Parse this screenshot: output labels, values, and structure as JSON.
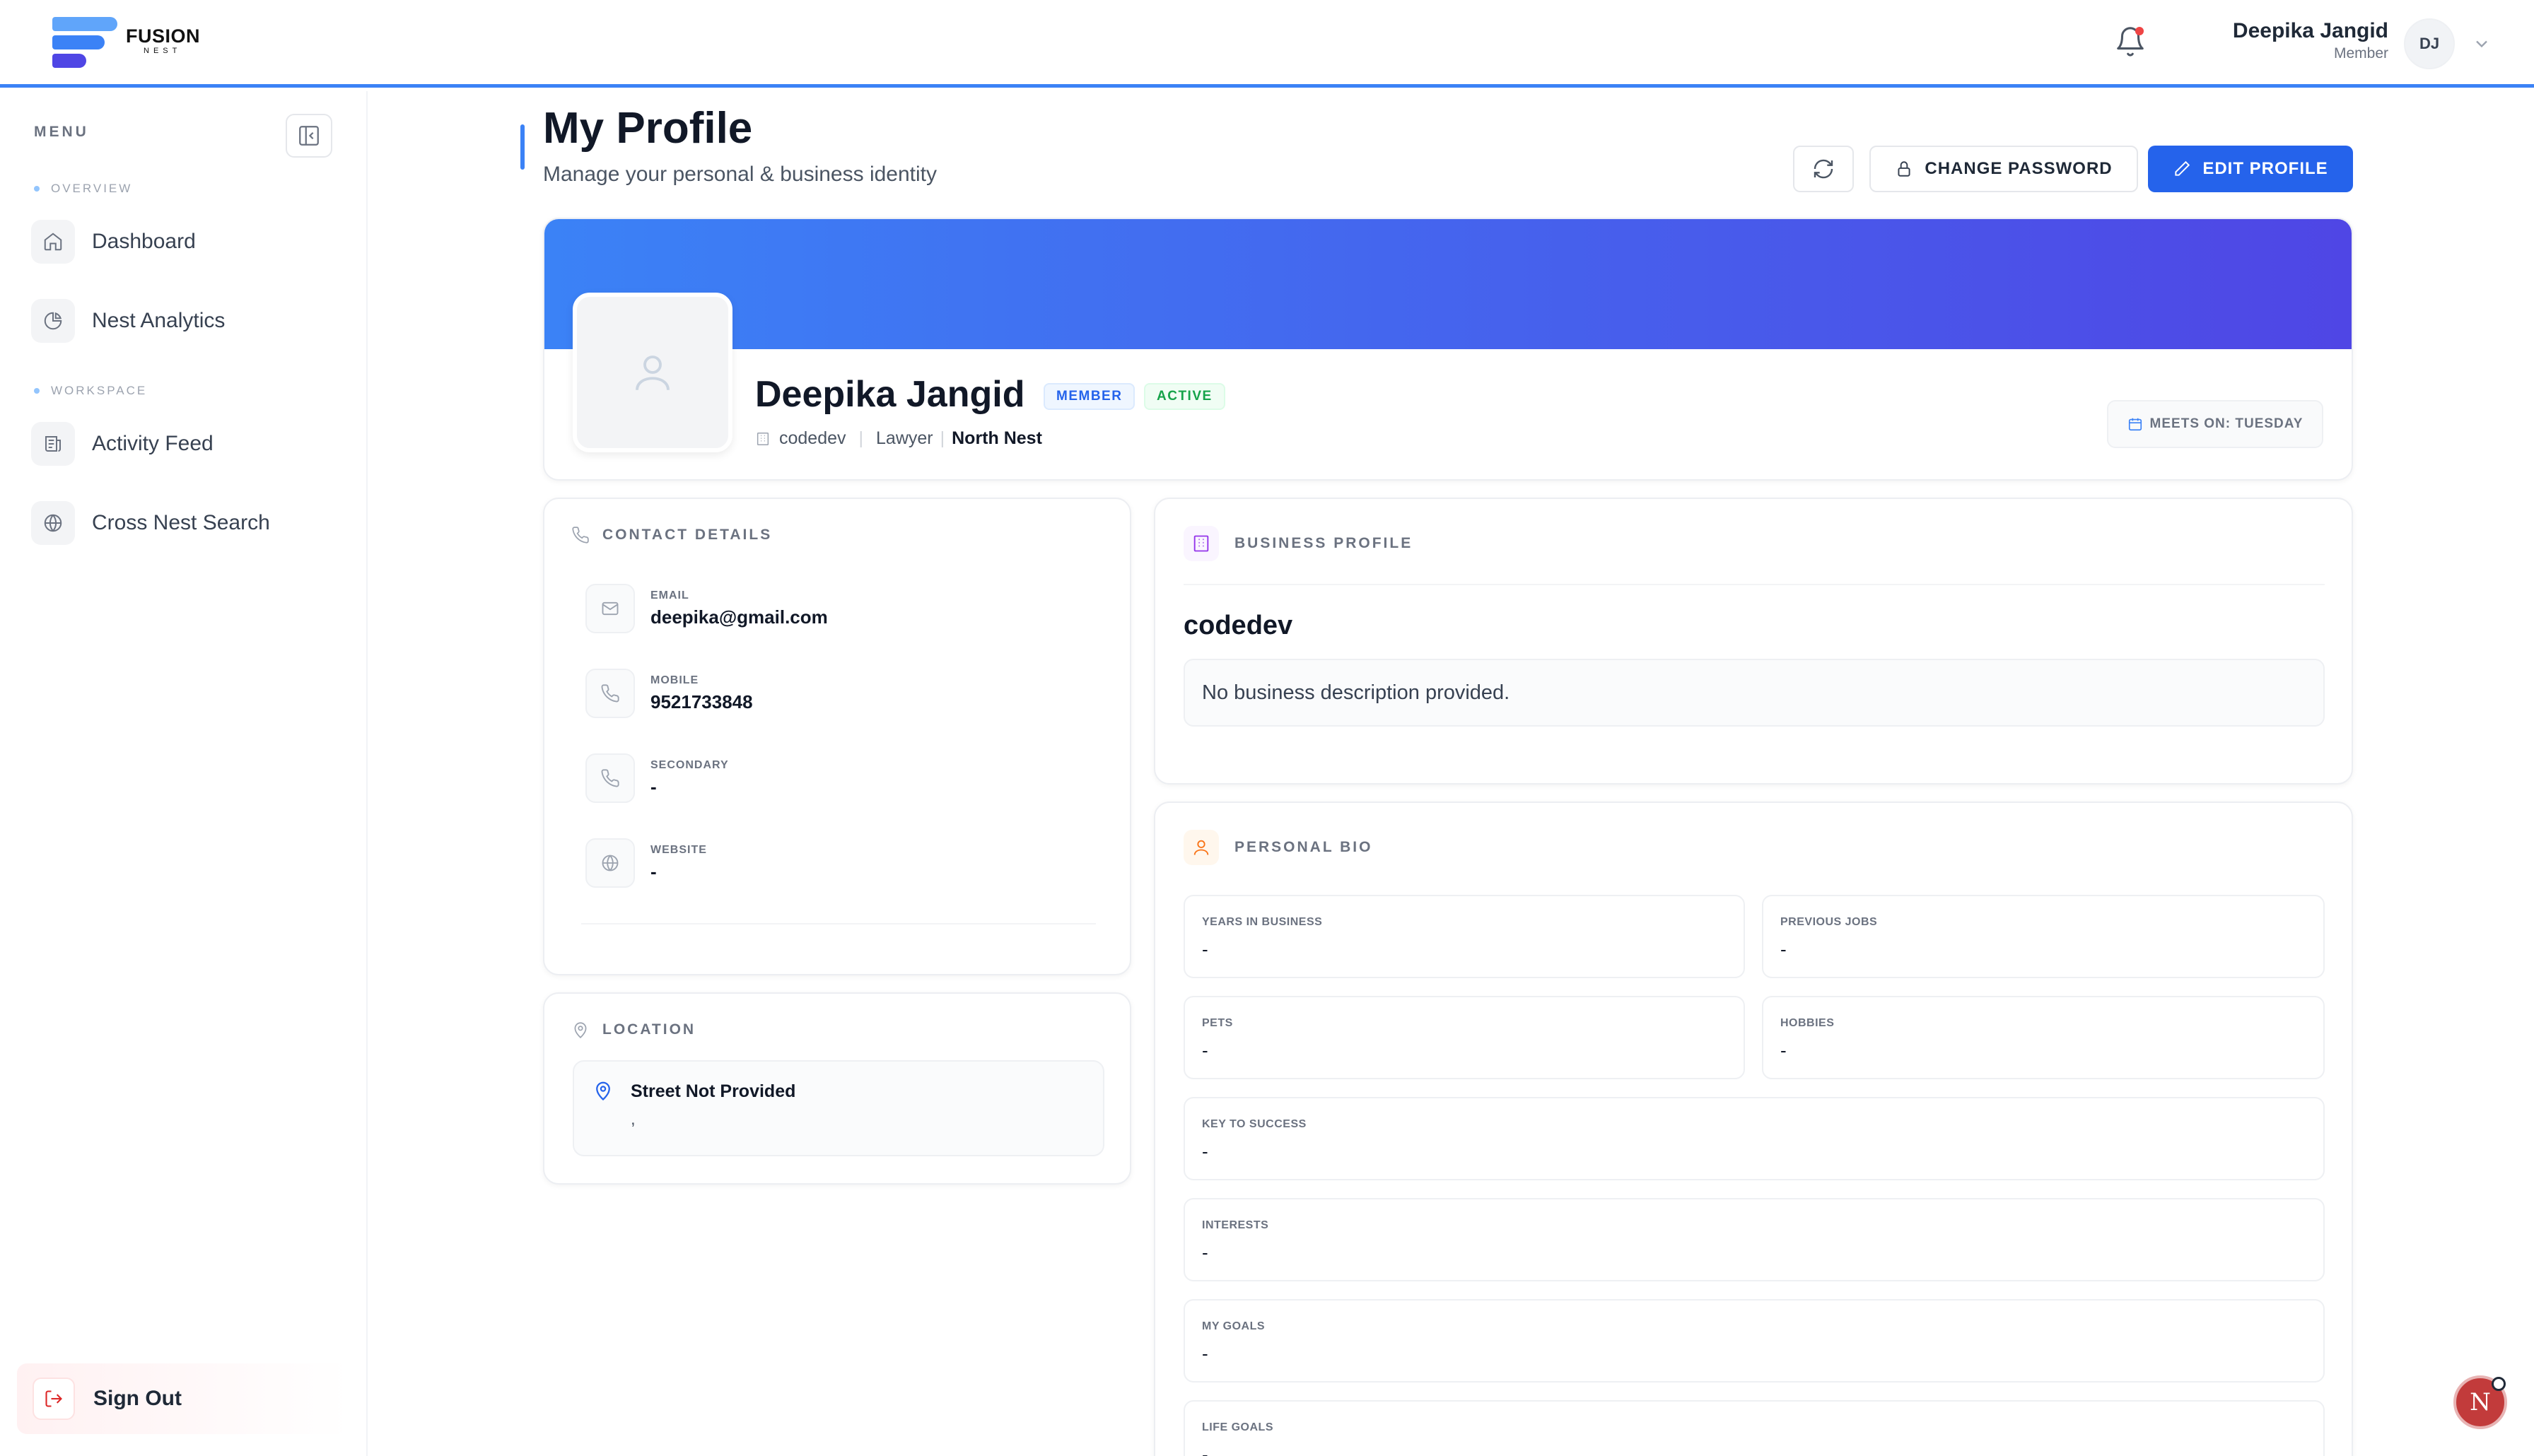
{
  "brand": {
    "name": "FUSION",
    "sub": "NEST"
  },
  "header": {
    "user_name": "Deepika Jangid",
    "user_role": "Member",
    "avatar_initials": "DJ"
  },
  "sidebar": {
    "menu_label": "MENU",
    "sections": [
      {
        "label": "OVERVIEW",
        "items": [
          {
            "label": "Dashboard",
            "icon": "home-icon"
          },
          {
            "label": "Nest Analytics",
            "icon": "pie-chart-icon"
          }
        ]
      },
      {
        "label": "WORKSPACE",
        "items": [
          {
            "label": "Activity Feed",
            "icon": "feed-icon"
          },
          {
            "label": "Cross Nest Search",
            "icon": "globe-icon"
          }
        ]
      }
    ],
    "signout_label": "Sign Out"
  },
  "page": {
    "title": "My Profile",
    "subtitle": "Manage your personal & business identity",
    "change_password_label": "CHANGE PASSWORD",
    "edit_profile_label": "EDIT PROFILE"
  },
  "profile": {
    "name": "Deepika Jangid",
    "badge_member": "MEMBER",
    "badge_active": "ACTIVE",
    "company": "codedev",
    "profession": "Lawyer",
    "nest": "North Nest",
    "meets_on": "MEETS ON: TUESDAY"
  },
  "contact": {
    "title": "CONTACT DETAILS",
    "rows": [
      {
        "label": "EMAIL",
        "value": "deepika@gmail.com"
      },
      {
        "label": "MOBILE",
        "value": "9521733848"
      },
      {
        "label": "SECONDARY",
        "value": "-"
      },
      {
        "label": "WEBSITE",
        "value": "-"
      }
    ]
  },
  "location": {
    "title": "LOCATION",
    "street": "Street Not Provided",
    "city": ","
  },
  "business": {
    "title": "BUSINESS PROFILE",
    "name": "codedev",
    "description": "No business description provided."
  },
  "bio": {
    "title": "PERSONAL BIO",
    "fields": [
      {
        "label": "YEARS IN BUSINESS",
        "value": "-"
      },
      {
        "label": "PREVIOUS JOBS",
        "value": "-"
      },
      {
        "label": "PETS",
        "value": "-"
      },
      {
        "label": "HOBBIES",
        "value": "-"
      },
      {
        "label": "KEY TO SUCCESS",
        "value": "-"
      },
      {
        "label": "INTERESTS",
        "value": "-"
      },
      {
        "label": "MY GOALS",
        "value": "-"
      },
      {
        "label": "LIFE GOALS",
        "value": "-"
      }
    ]
  },
  "fab": {
    "letter": "N"
  },
  "colors": {
    "accent": "#2563eb",
    "banner_start": "#3b82f6",
    "banner_end": "#4f46e5"
  }
}
